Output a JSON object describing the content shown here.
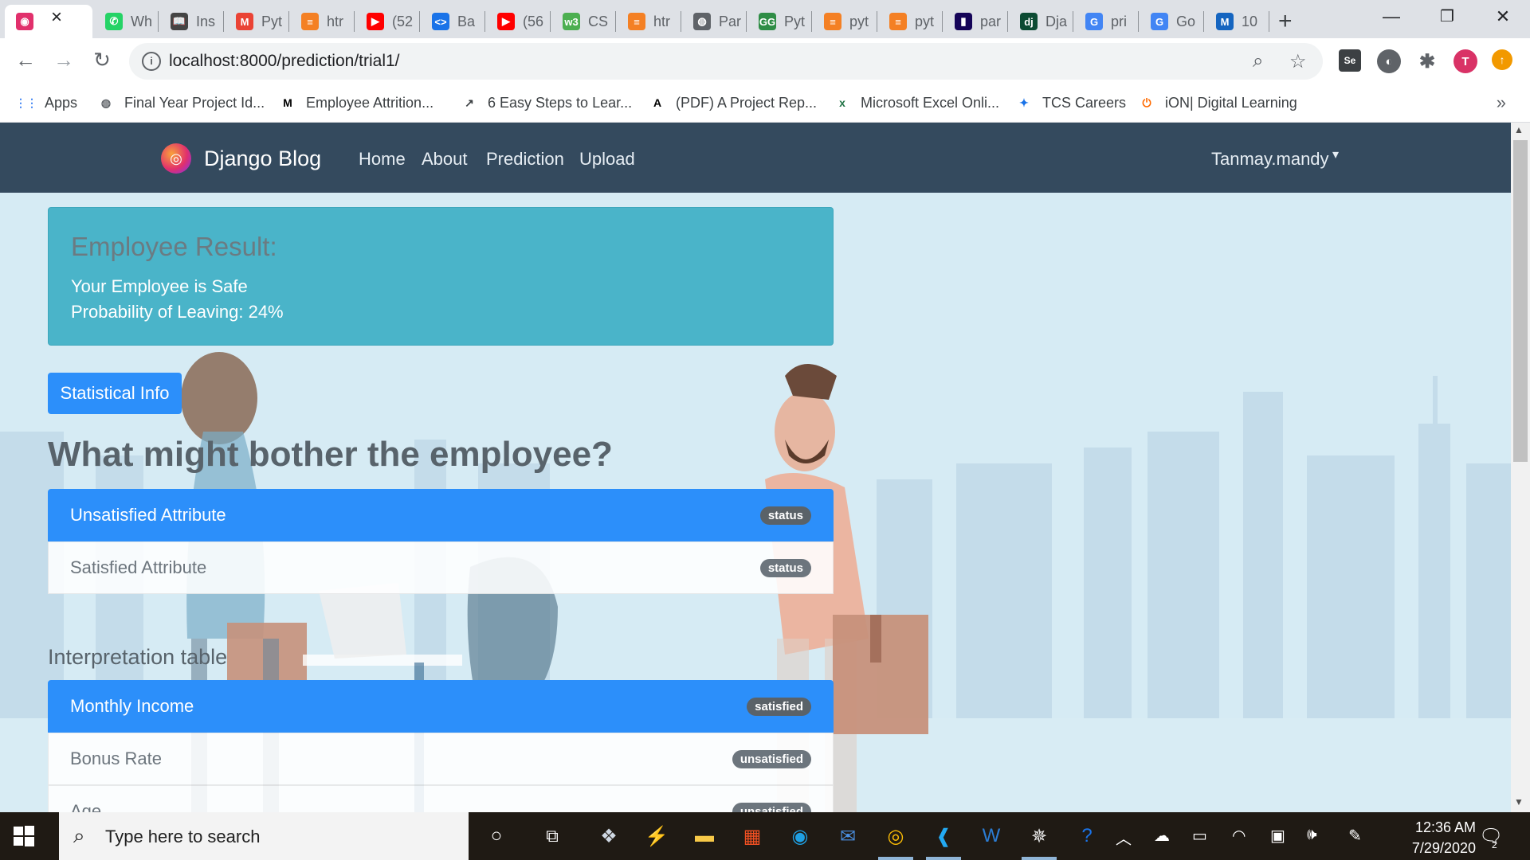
{
  "browser": {
    "tabs": [
      {
        "title": "",
        "color": "#e1306c",
        "icon": "instagram-icon",
        "glyph": "◉",
        "active": true
      },
      {
        "title": "Wh",
        "color": "#25d366",
        "icon": "whatsapp-icon",
        "glyph": "✆"
      },
      {
        "title": "Ins",
        "color": "#444444",
        "icon": "book-icon",
        "glyph": "📖"
      },
      {
        "title": "Pyt",
        "color": "#ea4335",
        "icon": "gmail-icon",
        "glyph": "M"
      },
      {
        "title": "htr",
        "color": "#f48024",
        "icon": "stackoverflow-icon",
        "glyph": "≡"
      },
      {
        "title": "(52",
        "color": "#ff0000",
        "icon": "youtube-icon",
        "glyph": "▶"
      },
      {
        "title": "Ba",
        "color": "#1a73e8",
        "icon": "code-icon",
        "glyph": "<>"
      },
      {
        "title": "(56",
        "color": "#ff0000",
        "icon": "youtube-icon",
        "glyph": "▶"
      },
      {
        "title": "CS",
        "color": "#4caf50",
        "icon": "w3schools-icon",
        "glyph": "w3"
      },
      {
        "title": "htr",
        "color": "#f48024",
        "icon": "stackoverflow-icon",
        "glyph": "≡"
      },
      {
        "title": "Par",
        "color": "#5f6368",
        "icon": "globe-icon",
        "glyph": "◍"
      },
      {
        "title": "Pyt",
        "color": "#2f8d46",
        "icon": "geeksforgeeks-icon",
        "glyph": "GG"
      },
      {
        "title": "pyt",
        "color": "#f48024",
        "icon": "stackoverflow-icon",
        "glyph": "≡"
      },
      {
        "title": "pyt",
        "color": "#f48024",
        "icon": "stackoverflow-icon",
        "glyph": "≡"
      },
      {
        "title": "par",
        "color": "#150458",
        "icon": "pandas-icon",
        "glyph": "▮"
      },
      {
        "title": "Dja",
        "color": "#0c4b33",
        "icon": "django-icon",
        "glyph": "dj"
      },
      {
        "title": "pri",
        "color": "#4285f4",
        "icon": "google-icon",
        "glyph": "G"
      },
      {
        "title": "Go",
        "color": "#4285f4",
        "icon": "google-icon",
        "glyph": "G"
      },
      {
        "title": "10",
        "color": "#1565c0",
        "icon": "m-logo-icon",
        "glyph": "M"
      }
    ],
    "url": "localhost:8000/prediction/trial1/",
    "profile_initial": "T",
    "bookmarks": [
      {
        "label": "Apps",
        "icon": "apps-grid-icon",
        "glyph": "⋮⋮",
        "color": "#4285f4"
      },
      {
        "label": "Final Year Project Id...",
        "icon": "globe-icon",
        "glyph": "◍",
        "color": "#5f6368"
      },
      {
        "label": "Employee Attrition...",
        "icon": "medium-icon",
        "glyph": "M",
        "color": "#000000"
      },
      {
        "label": "6 Easy Steps to Lear...",
        "icon": "chart-line-icon",
        "glyph": "↗",
        "color": "#3c4043"
      },
      {
        "label": "(PDF) A Project Rep...",
        "icon": "academia-icon",
        "glyph": "A",
        "color": "#000000"
      },
      {
        "label": "Microsoft Excel Onli...",
        "icon": "excel-icon",
        "glyph": "x",
        "color": "#217346"
      },
      {
        "label": "TCS Careers",
        "icon": "tata-icon",
        "glyph": "✦",
        "color": "#1a73e8"
      },
      {
        "label": "iON| Digital Learning",
        "icon": "ion-power-icon",
        "glyph": "⏻",
        "color": "#ff6a00"
      }
    ]
  },
  "site": {
    "brand": "Django Blog",
    "nav": [
      "Home",
      "About",
      "Prediction",
      "Upload"
    ],
    "user": "Tanmay.mandy"
  },
  "result": {
    "title": "Employee Result:",
    "status_line": "Your Employee is Safe",
    "probability_line": "Probability of Leaving: 24%"
  },
  "stat_button": "Statistical Info",
  "bother": {
    "heading": "What might bother the employee?",
    "items": [
      {
        "label": "Unsatisfied Attribute",
        "badge": "status",
        "active": true
      },
      {
        "label": "Satisfied Attribute",
        "badge": "status",
        "active": false
      }
    ]
  },
  "interpretation": {
    "heading": "Interpretation table",
    "rows": [
      {
        "label": "Monthly Income",
        "badge": "satisfied",
        "active": true
      },
      {
        "label": "Bonus Rate",
        "badge": "unsatisfied",
        "active": false
      },
      {
        "label": "Age",
        "badge": "unsatisfied",
        "active": false
      }
    ]
  },
  "taskbar": {
    "search_placeholder": "Type here to search",
    "time": "12:36 AM",
    "date": "7/29/2020",
    "notification_count": "2"
  },
  "colors": {
    "navbar": "#344a5e",
    "alert": "#4ab4c9",
    "primary": "#2c8ffa",
    "badge": "#6c757d",
    "page_bg": "#d6ebf4"
  }
}
